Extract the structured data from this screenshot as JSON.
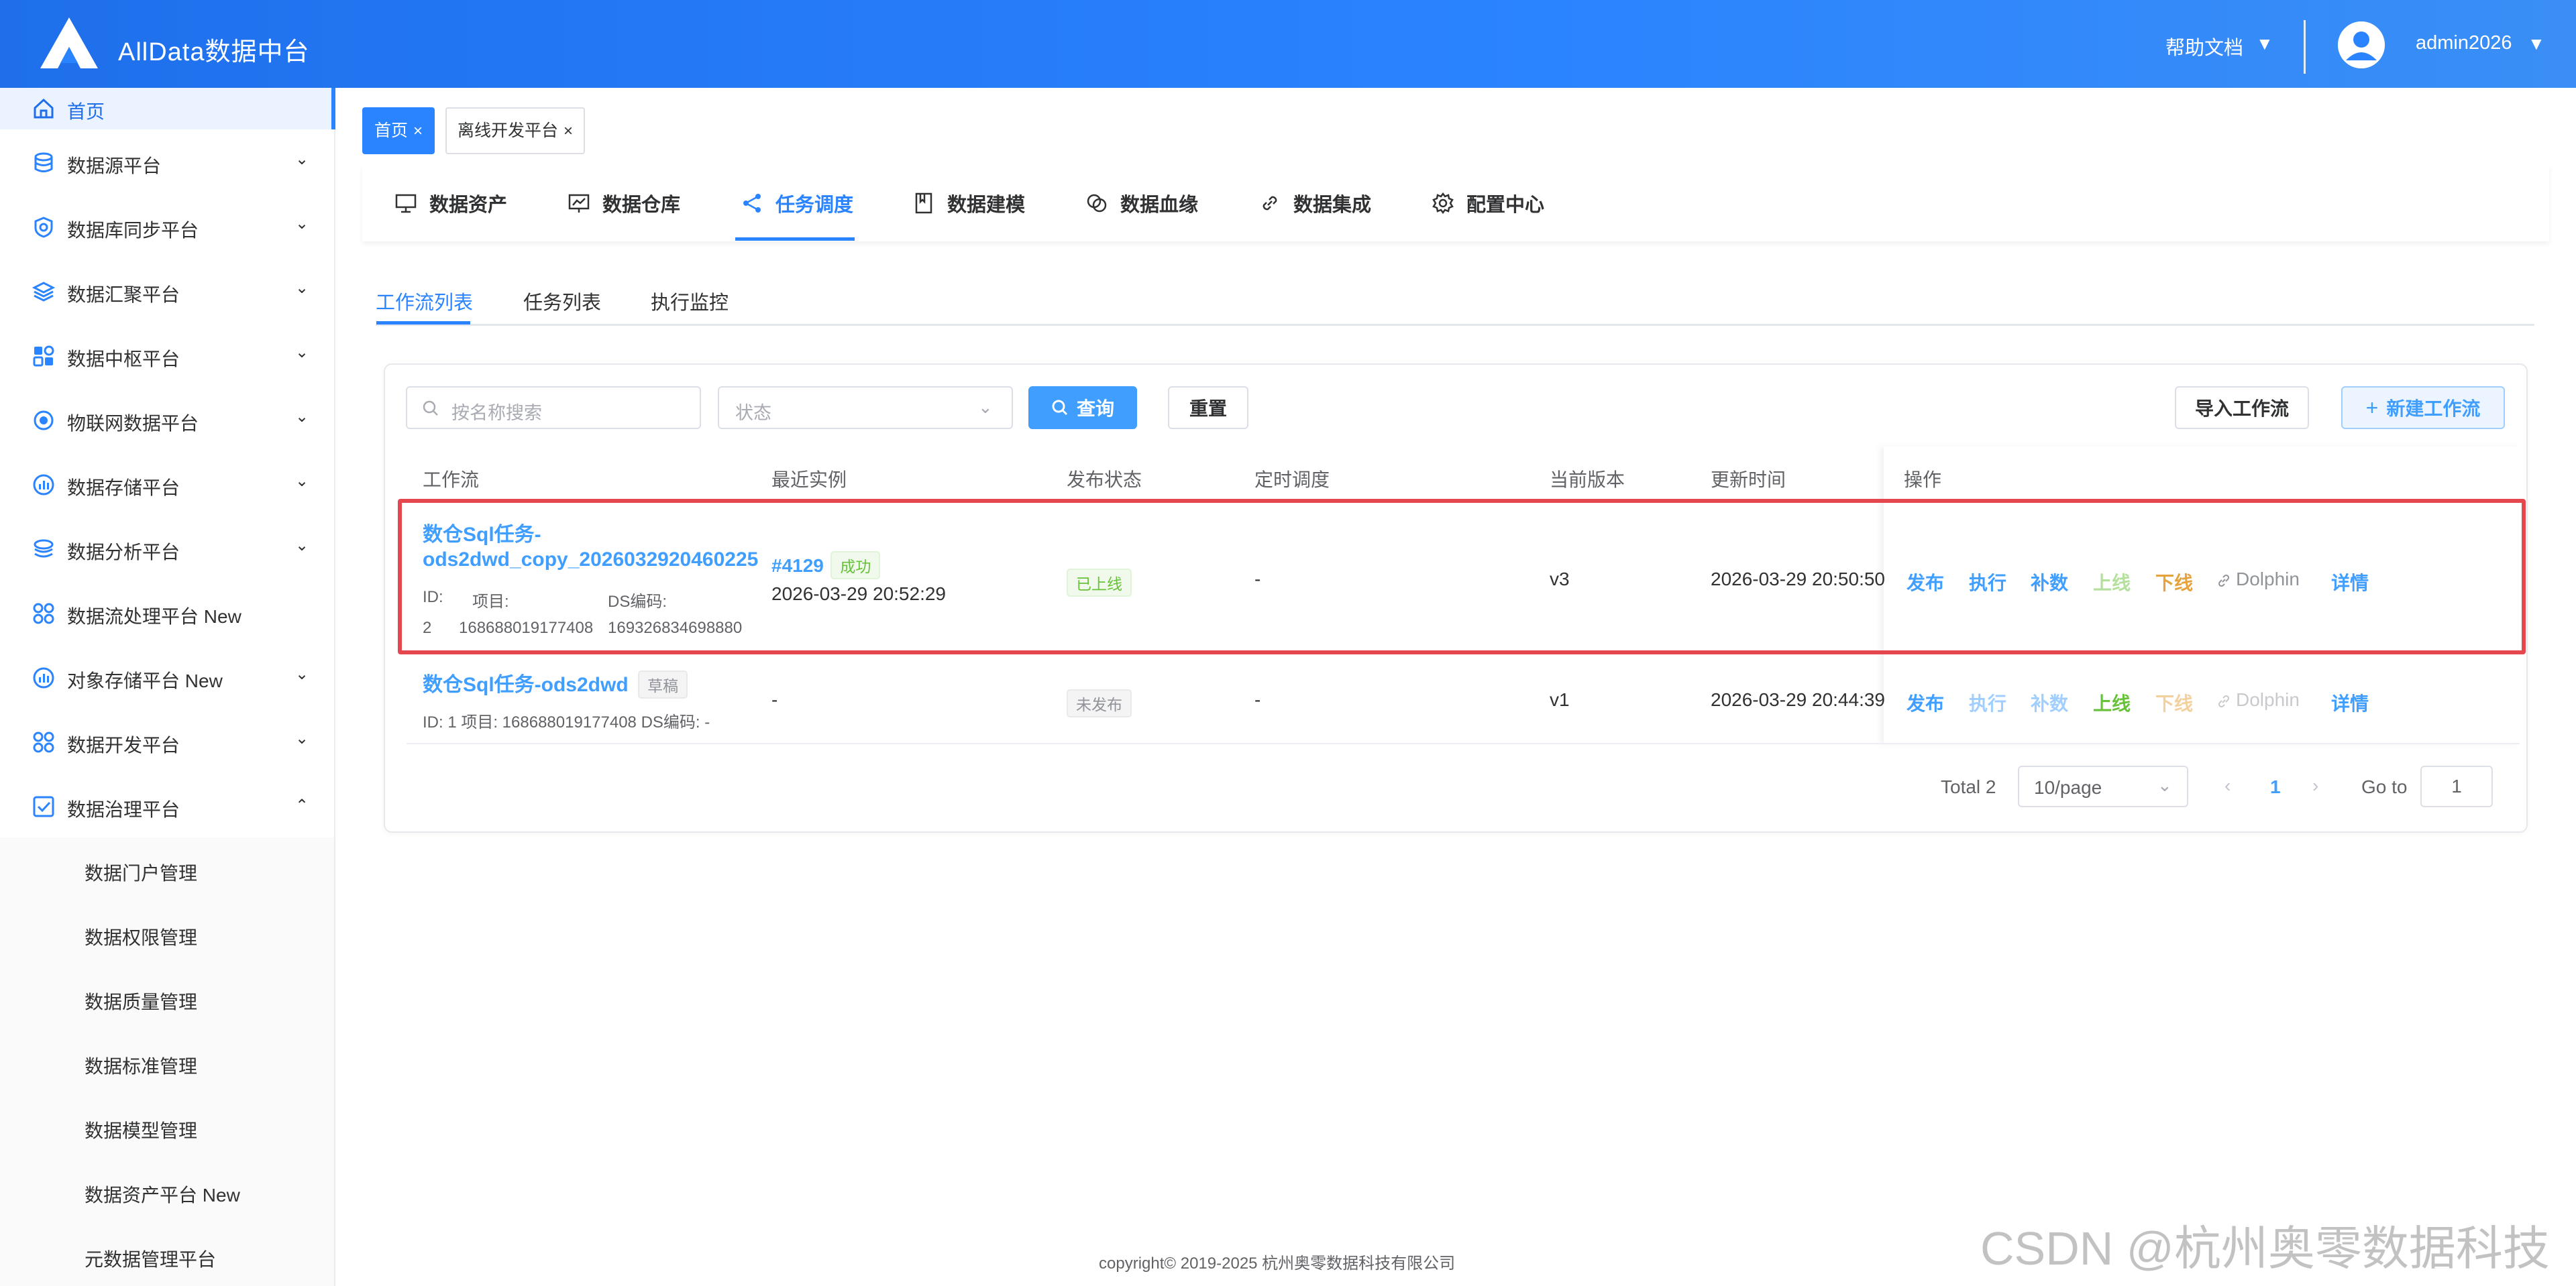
{
  "header": {
    "brand": "AllData数据中台",
    "help": "帮助文档",
    "user": "admin2026",
    "color_primary": "#2b84ff"
  },
  "sidebar": {
    "home": "首页",
    "items": [
      {
        "label": "数据源平台",
        "icon": "database-icon"
      },
      {
        "label": "数据库同步平台",
        "icon": "sync-shield-icon"
      },
      {
        "label": "数据汇聚平台",
        "icon": "layers-icon"
      },
      {
        "label": "数据中枢平台",
        "icon": "grid-icon"
      },
      {
        "label": "物联网数据平台",
        "icon": "iot-icon"
      },
      {
        "label": "数据存储平台",
        "icon": "storage-icon"
      },
      {
        "label": "数据分析平台",
        "icon": "analysis-icon"
      },
      {
        "label": "数据流处理平台 New",
        "icon": "stream-icon"
      },
      {
        "label": "对象存储平台 New",
        "icon": "object-storage-icon"
      },
      {
        "label": "数据开发平台",
        "icon": "dev-icon"
      },
      {
        "label": "数据治理平台",
        "icon": "governance-icon"
      }
    ],
    "sub_items": [
      "数据门户管理",
      "数据权限管理",
      "数据质量管理",
      "数据标准管理",
      "数据模型管理",
      "数据资产平台 New",
      "元数据管理平台"
    ]
  },
  "page_tabs": [
    {
      "label": "首页",
      "close": "×"
    },
    {
      "label": "离线开发平台",
      "close": "×"
    }
  ],
  "menu": [
    {
      "label": "数据资产",
      "icon": "monitor-icon"
    },
    {
      "label": "数据仓库",
      "icon": "chart-board-icon"
    },
    {
      "label": "任务调度",
      "icon": "share-icon"
    },
    {
      "label": "数据建模",
      "icon": "book-icon"
    },
    {
      "label": "数据血缘",
      "icon": "link-circles-icon"
    },
    {
      "label": "数据集成",
      "icon": "chain-link-icon"
    },
    {
      "label": "配置中心",
      "icon": "gear-icon"
    }
  ],
  "sub_tabs": [
    "工作流列表",
    "任务列表",
    "执行监控"
  ],
  "filters": {
    "search_placeholder": "按名称搜索",
    "status_placeholder": "状态",
    "query": "查询",
    "reset": "重置",
    "import": "导入工作流",
    "new": "新建工作流"
  },
  "table": {
    "headers": [
      "工作流",
      "最近实例",
      "发布状态",
      "定时调度",
      "当前版本",
      "更新时间",
      "操作"
    ],
    "rows": [
      {
        "name_line1": "数仓Sql任务-",
        "name_line2": "ods2dwd_copy_2026032920460225",
        "id_label": "ID:",
        "id_value": "2",
        "project_label": "项目:",
        "project_value": "168688019177408",
        "ds_label": "DS编码:",
        "ds_value": "169326834698880",
        "instance_id": "#4129",
        "instance_status": "成功",
        "instance_time": "2026-03-29 20:52:29",
        "publish_status": "已上线",
        "schedule": "-",
        "version": "v3",
        "updated": "2026-03-29 20:50:50"
      },
      {
        "name": "数仓Sql任务-ods2dwd",
        "draft": "草稿",
        "meta": "ID: 1    项目: 168688019177408    DS编码: -",
        "instance": "-",
        "publish_status": "未发布",
        "schedule": "-",
        "version": "v1",
        "updated": "2026-03-29 20:44:39"
      }
    ],
    "ops": [
      "发布",
      "执行",
      "补数",
      "上线",
      "下线",
      "Dolphin",
      "详情"
    ]
  },
  "pagination": {
    "total": "Total 2",
    "page_size": "10/page",
    "prev": "‹",
    "current": "1",
    "next": "›",
    "goto_label": "Go to",
    "goto_value": "1"
  },
  "footer": "copyright© 2019-2025 杭州奥零数据科技有限公司",
  "watermark": "CSDN @杭州奥零数据科技"
}
